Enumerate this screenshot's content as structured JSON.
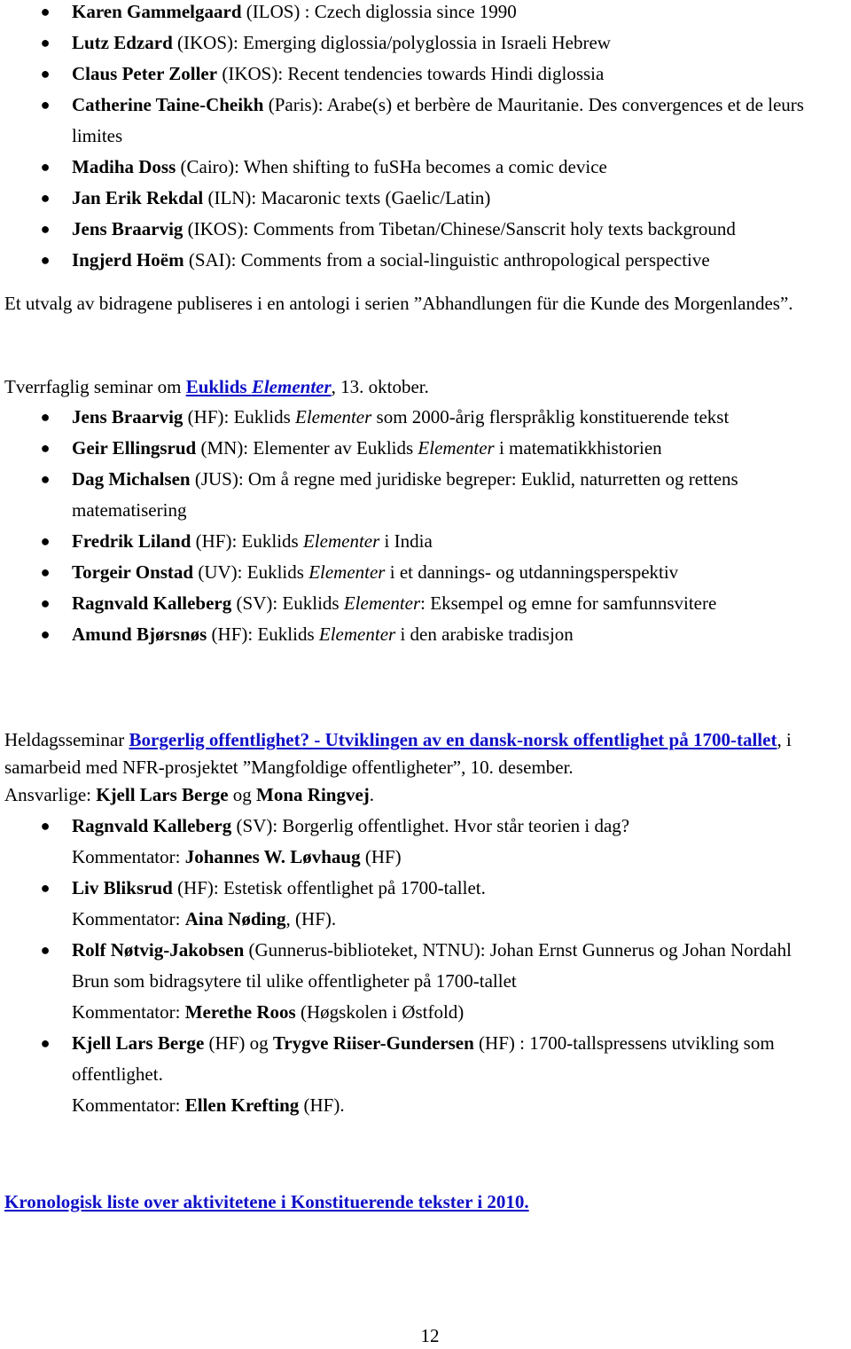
{
  "section1": {
    "items": [
      {
        "name": "Karen Gammelgaard",
        "rest": " (ILOS) : Czech diglossia since 1990"
      },
      {
        "name": "Lutz Edzard",
        "rest": " (IKOS): Emerging diglossia/polyglossia in Israeli Hebrew"
      },
      {
        "name": "Claus Peter Zoller",
        "rest": " (IKOS): Recent tendencies towards Hindi diglossia"
      },
      {
        "name": "Catherine Taine-Cheikh",
        "rest": " (Paris): Arabe(s) et berbère de Mauritanie. Des convergences et de leurs limites"
      },
      {
        "name": "Madiha Doss",
        "rest": " (Cairo): When shifting to fuSHa becomes a comic device"
      },
      {
        "name": "Jan Erik Rekdal",
        "rest": " (ILN): Macaronic texts (Gaelic/Latin)"
      },
      {
        "name": "Jens Braarvig",
        "rest": " (IKOS): Comments from Tibetan/Chinese/Sanscrit holy texts background"
      },
      {
        "name": "Ingjerd Hoëm",
        "rest": " (SAI): Comments from a social-linguistic anthropological perspective"
      }
    ],
    "note": "Et utvalg av bidragene publiseres i en antologi i serien ”Abhandlungen für die Kunde des Morgenlandes”."
  },
  "section2": {
    "intro_before": "Tverrfaglig seminar om ",
    "link_part1": "Euklids ",
    "link_part2": "Elementer",
    "intro_after": ",  13. oktober.",
    "items": [
      {
        "name": "Jens Braarvig",
        "pre": " (HF): Euklids ",
        "it": "Elementer",
        "post": " som 2000-årig flerspråklig konstituerende tekst"
      },
      {
        "name": "Geir Ellingsrud",
        "pre": " (MN): Elementer av Euklids ",
        "it": "Elementer",
        "post": " i matematikkhistorien"
      },
      {
        "name": "Dag Michalsen",
        "pre": " (JUS): Om å regne med juridiske begreper: Euklid, naturretten og rettens matematisering",
        "it": "",
        "post": ""
      },
      {
        "name": "Fredrik Liland",
        "pre": " (HF): Euklids ",
        "it": "Elementer",
        "post": " i India"
      },
      {
        "name": "Torgeir Onstad",
        "pre": " (UV): Euklids ",
        "it": "Elementer",
        "post": " i et dannings- og utdanningsperspektiv"
      },
      {
        "name": "Ragnvald Kalleberg",
        "pre": " (SV): Euklids ",
        "it": "Elementer",
        "post": ": Eksempel og emne for samfunnsvitere"
      },
      {
        "name": "Amund Bjørsnøs",
        "pre": " (HF): Euklids ",
        "it": "Elementer",
        "post": " i den arabiske tradisjon"
      }
    ]
  },
  "section3": {
    "intro_before": "Heldagsseminar ",
    "link": "Borgerlig offentlighet? - Utviklingen av en dansk-norsk offentlighet på 1700-tallet",
    "intro_after": ", i samarbeid med NFR-prosjektet ”Mangfoldige offentligheter”, 10. desember.",
    "ansvarlige_label": "Ansvarlige: ",
    "ansvarlige_1": "Kjell Lars Berge",
    "ansvarlige_og": " og ",
    "ansvarlige_2": "Mona Ringvej",
    "ansvarlige_end": ".",
    "items": [
      {
        "name": "Ragnvald Kalleberg",
        "rest": " (SV): Borgerlig offentlighet. Hvor står teorien i dag?",
        "k_label": "Kommentator: ",
        "k_name": "Johannes W. Løvhaug",
        "k_rest": " (HF)"
      },
      {
        "name": "Liv Bliksrud",
        "rest": " (HF): Estetisk offentlighet på 1700-tallet.",
        "k_label": "Kommentator: ",
        "k_name": "Aina Nøding",
        "k_rest": ", (HF)."
      },
      {
        "name": "Rolf Nøtvig-Jakobsen",
        "rest": " (Gunnerus-biblioteket, NTNU): Johan Ernst Gunnerus og Johan Nordahl Brun som bidragsytere til ulike offentligheter på 1700-tallet",
        "k_label": "Kommentator: ",
        "k_name": "Merethe Roos",
        "k_rest": " (Høgskolen i Østfold)"
      }
    ],
    "last_item": {
      "name1": "Kjell Lars Berge",
      "mid1": " (HF)  og ",
      "name2": "Trygve Riiser-Gundersen",
      "rest": " (HF) : 1700-tallspressens utvikling som offentlighet.",
      "k_label": "Kommentator: ",
      "k_name": "Ellen Krefting",
      "k_rest": " (HF)."
    }
  },
  "footer_link": "Kronologisk liste over aktivitetene i Konstituerende tekster i 2010.",
  "page_number": "12",
  "colors": {
    "link": "#1010c8",
    "text": "#000000"
  }
}
